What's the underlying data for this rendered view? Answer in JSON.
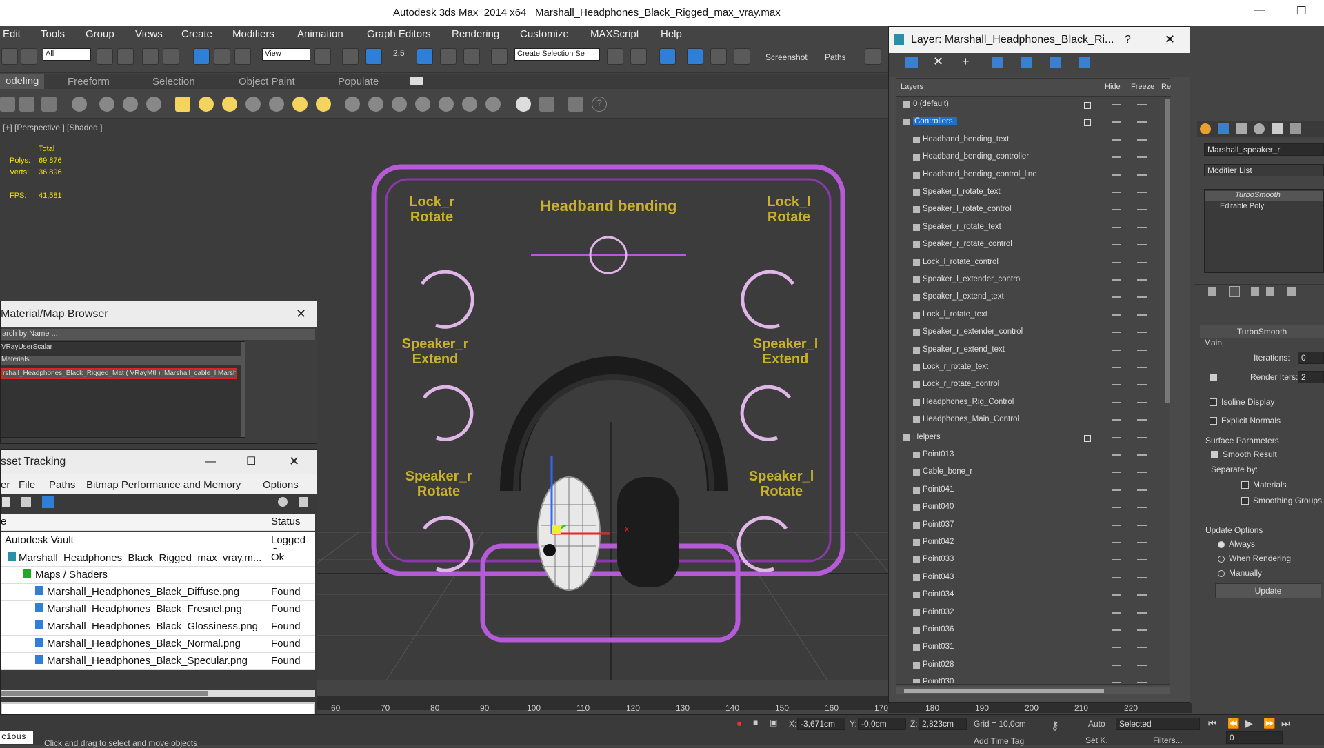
{
  "title": {
    "app": "Autodesk 3ds Max  2014 x64",
    "file": "Marshall_Headphones_Black_Rigged_max_vray.max"
  },
  "menu": [
    "Edit",
    "Tools",
    "Group",
    "Views",
    "Create",
    "Modifiers",
    "Animation",
    "Graph Editors",
    "Rendering",
    "Customize",
    "MAXScript",
    "Help"
  ],
  "toolbar": {
    "filter": "All",
    "view": "View",
    "selection_set": "Create Selection Se",
    "num": "2.5",
    "screenshot": "Screenshot",
    "paths": "Paths"
  },
  "ribbon": [
    "odeling",
    "Freeform",
    "Selection",
    "Object Paint",
    "Populate"
  ],
  "viewport": {
    "label": "[+] [Perspective ] [Shaded ]",
    "total": "Total",
    "polys_label": "Polys:",
    "polys": "69 876",
    "verts_label": "Verts:",
    "verts": "36 896",
    "fps_label": "FPS:",
    "fps": "41,581",
    "axis_x": "x"
  },
  "rig": {
    "lock_r": "Lock_r\nRotate",
    "lock_l": "Lock_l\nRotate",
    "headband": "Headband bending",
    "spk_r_ext": "Speaker_r\nExtend",
    "spk_l_ext": "Speaker_l\nExtend",
    "spk_r_rot": "Speaker_r\nRotate",
    "spk_l_rot": "Speaker_l\nRotate"
  },
  "material_browser": {
    "title": "Material/Map Browser",
    "search": "arch by Name ...",
    "item1": "VRayUserScalar",
    "group": "Materials",
    "mat": "rshall_Headphones_Black_Rigged_Mat ( VRayMtl ) [Marshall_cable_l,Marsha..."
  },
  "asset_tracking": {
    "title": "sset Tracking",
    "menu": [
      "er",
      "File",
      "Paths",
      "Bitmap Performance and Memory",
      "Options"
    ],
    "col_name": "e",
    "col_status": "Status",
    "rows": [
      {
        "name": "Autodesk Vault",
        "status": "Logged Ou"
      },
      {
        "name": "Marshall_Headphones_Black_Rigged_max_vray.m...",
        "status": "Ok"
      },
      {
        "name": "Maps / Shaders",
        "status": ""
      },
      {
        "name": "Marshall_Headphones_Black_Diffuse.png",
        "status": "Found"
      },
      {
        "name": "Marshall_Headphones_Black_Fresnel.png",
        "status": "Found"
      },
      {
        "name": "Marshall_Headphones_Black_Glossiness.png",
        "status": "Found"
      },
      {
        "name": "Marshall_Headphones_Black_Normal.png",
        "status": "Found"
      },
      {
        "name": "Marshall_Headphones_Black_Specular.png",
        "status": "Found"
      }
    ]
  },
  "layer": {
    "title": "Layer: Marshall_Headphones_Black_Ri...",
    "help": "?",
    "col_layers": "Layers",
    "col_hide": "Hide",
    "col_freeze": "Freeze",
    "col_r": "Re",
    "rows": [
      {
        "name": "0 (default)",
        "indent": 0
      },
      {
        "name": "Controllers",
        "indent": 0
      },
      {
        "name": "Headband_bending_text",
        "indent": 1
      },
      {
        "name": "Headband_bending_controller",
        "indent": 1
      },
      {
        "name": "Headband_bending_control_line",
        "indent": 1
      },
      {
        "name": "Speaker_l_rotate_text",
        "indent": 1
      },
      {
        "name": "Speaker_l_rotate_control",
        "indent": 1
      },
      {
        "name": "Speaker_r_rotate_text",
        "indent": 1
      },
      {
        "name": "Speaker_r_rotate_control",
        "indent": 1
      },
      {
        "name": "Lock_l_rotate_control",
        "indent": 1
      },
      {
        "name": "Speaker_l_extender_control",
        "indent": 1
      },
      {
        "name": "Speaker_l_extend_text",
        "indent": 1
      },
      {
        "name": "Lock_l_rotate_text",
        "indent": 1
      },
      {
        "name": "Speaker_r_extender_control",
        "indent": 1
      },
      {
        "name": "Speaker_r_extend_text",
        "indent": 1
      },
      {
        "name": "Lock_r_rotate_text",
        "indent": 1
      },
      {
        "name": "Lock_r_rotate_control",
        "indent": 1
      },
      {
        "name": "Headphones_Rig_Control",
        "indent": 1
      },
      {
        "name": "Headphones_Main_Control",
        "indent": 1
      },
      {
        "name": "Helpers",
        "indent": 0
      },
      {
        "name": "Point013",
        "indent": 1
      },
      {
        "name": "Cable_bone_r",
        "indent": 1
      },
      {
        "name": "Point041",
        "indent": 1
      },
      {
        "name": "Point040",
        "indent": 1
      },
      {
        "name": "Point037",
        "indent": 1
      },
      {
        "name": "Point042",
        "indent": 1
      },
      {
        "name": "Point033",
        "indent": 1
      },
      {
        "name": "Point043",
        "indent": 1
      },
      {
        "name": "Point034",
        "indent": 1
      },
      {
        "name": "Point032",
        "indent": 1
      },
      {
        "name": "Point036",
        "indent": 1
      },
      {
        "name": "Point031",
        "indent": 1
      },
      {
        "name": "Point028",
        "indent": 1
      },
      {
        "name": "Point030",
        "indent": 1
      }
    ]
  },
  "command_panel": {
    "object_name": "Marshall_speaker_r",
    "modifier_list": "Modifier List",
    "stack": [
      "TurboSmooth",
      "Editable Poly"
    ],
    "rollout": "TurboSmooth",
    "main": "Main",
    "iterations_label": "Iterations:",
    "iterations": "0",
    "render_iters_label": "Render Iters:",
    "render_iters": "2",
    "isoline": "Isoline Display",
    "explicit": "Explicit Normals",
    "surface": "Surface Parameters",
    "smooth_result": "Smooth Result",
    "separate_by": "Separate by:",
    "materials": "Materials",
    "smoothing_groups": "Smoothing Groups",
    "update_options": "Update Options",
    "always": "Always",
    "when_rendering": "When Rendering",
    "manually": "Manually",
    "update": "Update"
  },
  "timeline": [
    "60",
    "70",
    "80",
    "90",
    "100",
    "110",
    "120",
    "130",
    "140",
    "150",
    "160",
    "170",
    "180",
    "190",
    "200",
    "210",
    "220"
  ],
  "status": {
    "maxscript": "cious",
    "prompt": "Click and drag to select and move objects",
    "x_label": "X:",
    "x": "-3,671cm",
    "y_label": "Y:",
    "y": "-0,0cm",
    "z_label": "Z:",
    "z": "2,823cm",
    "grid": "Grid = 10,0cm",
    "add_time_tag": "Add Time Tag",
    "auto": "Auto",
    "set_key": "Set K.",
    "selected": "Selected",
    "filters": "Filters...",
    "frame": "0"
  }
}
